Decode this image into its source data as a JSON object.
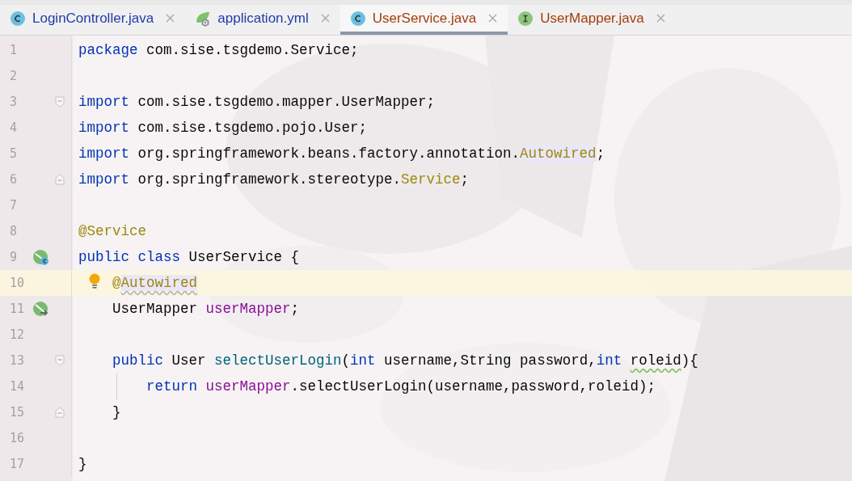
{
  "tabs": [
    {
      "label": "LoginController.java",
      "kind": "class",
      "modified": false,
      "selected": false
    },
    {
      "label": "application.yml",
      "kind": "spring-config",
      "modified": false,
      "selected": false
    },
    {
      "label": "UserService.java",
      "kind": "class",
      "modified": true,
      "selected": true
    },
    {
      "label": "UserMapper.java",
      "kind": "interface",
      "modified": true,
      "selected": false
    }
  ],
  "editor": {
    "lines": [
      {
        "number": "1",
        "tokens": [
          {
            "text": "package",
            "kind": "keyword"
          },
          {
            "text": " com.sise.tsgdemo.Service;",
            "kind": "plain"
          }
        ]
      },
      {
        "number": "2"
      },
      {
        "number": "3",
        "fold": {
          "kind": "start"
        },
        "tokens": [
          {
            "text": "import",
            "kind": "keyword"
          },
          {
            "text": " com.sise.tsgdemo.mapper.UserMapper;",
            "kind": "plain"
          }
        ]
      },
      {
        "number": "4",
        "tokens": [
          {
            "text": "import",
            "kind": "keyword"
          },
          {
            "text": " com.sise.tsgdemo.pojo.User;",
            "kind": "plain"
          }
        ]
      },
      {
        "number": "5",
        "tokens": [
          {
            "text": "import",
            "kind": "keyword"
          },
          {
            "text": " org.springframework.beans.factory.annotation.",
            "kind": "plain"
          },
          {
            "text": "Autowired",
            "kind": "annotation",
            "marked": true
          },
          {
            "text": ";",
            "kind": "plain"
          }
        ]
      },
      {
        "number": "6",
        "fold": {
          "kind": "end"
        },
        "tokens": [
          {
            "text": "import",
            "kind": "keyword"
          },
          {
            "text": " org.springframework.stereotype.",
            "kind": "plain"
          },
          {
            "text": "Service",
            "kind": "annotation"
          },
          {
            "text": ";",
            "kind": "plain"
          }
        ]
      },
      {
        "number": "7"
      },
      {
        "number": "8",
        "tokens": [
          {
            "text": "@Service",
            "kind": "annotation"
          }
        ]
      },
      {
        "number": "9",
        "gutter": {
          "kind": "bean-class"
        },
        "tokens": [
          {
            "text": "public class",
            "kind": "keyword"
          },
          {
            "text": " UserService {",
            "kind": "plain"
          }
        ],
        "children": [
          {
            "number": "10",
            "current": true,
            "bulb": true,
            "tokens": [
              {
                "text": "@",
                "kind": "annotation"
              },
              {
                "text": "Autowired",
                "kind": "annotation",
                "marked": true,
                "warning": true
              }
            ]
          },
          {
            "number": "11",
            "gutter": {
              "kind": "bean-injected"
            },
            "tokens": [
              {
                "text": "UserMapper ",
                "kind": "plain"
              },
              {
                "text": "userMapper",
                "kind": "field"
              },
              {
                "text": ";",
                "kind": "plain"
              }
            ]
          },
          {
            "number": "12"
          },
          {
            "number": "13",
            "fold": {
              "kind": "start"
            },
            "tokens": [
              {
                "text": "public",
                "kind": "keyword"
              },
              {
                "text": " User ",
                "kind": "plain"
              },
              {
                "text": "selectUserLogin",
                "kind": "method"
              },
              {
                "text": "(",
                "kind": "plain"
              },
              {
                "text": "int",
                "kind": "keyword"
              },
              {
                "text": " username,String password,",
                "kind": "plain"
              },
              {
                "text": "int",
                "kind": "keyword"
              },
              {
                "text": " roleid",
                "kind": "plain",
                "typo": true
              },
              {
                "text": "){",
                "kind": "plain"
              }
            ],
            "children": [
              {
                "number": "14",
                "guide": true,
                "tokens": [
                  {
                    "text": "return",
                    "kind": "keyword"
                  },
                  {
                    "text": " userMapper",
                    "kind": "field"
                  },
                  {
                    "text": ".selectUserLogin(username,password,roleid);",
                    "kind": "plain"
                  }
                ]
              }
            ]
          },
          {
            "number": "15",
            "fold": {
              "kind": "end"
            },
            "tokens": [
              {
                "text": "}",
                "kind": "plain"
              }
            ]
          },
          {
            "number": "16"
          }
        ]
      },
      {
        "number": "17",
        "tokens": [
          {
            "text": "}",
            "kind": "plain"
          }
        ]
      }
    ]
  }
}
